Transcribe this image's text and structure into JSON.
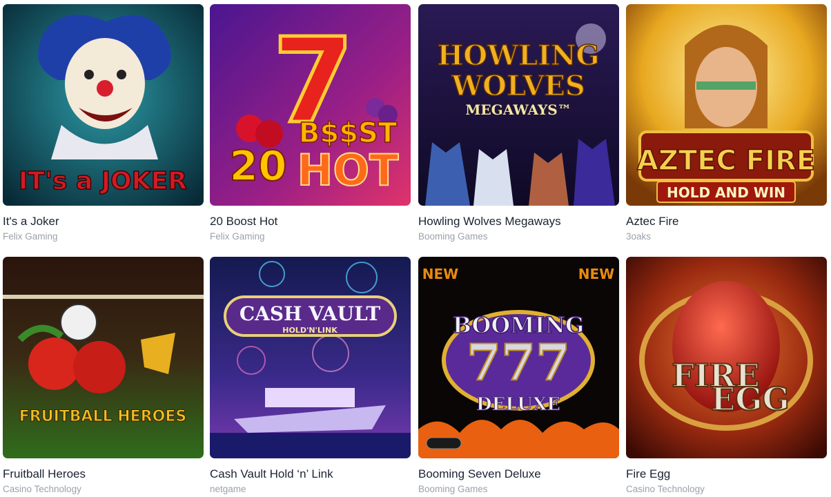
{
  "games": [
    {
      "title": "It's a Joker",
      "provider": "Felix Gaming",
      "art_text": [
        "IT's a JOKER"
      ],
      "art_colors": [
        "#0b3b4a",
        "#1d6f7a",
        "#c8102e"
      ]
    },
    {
      "title": "20 Boost Hot",
      "provider": "Felix Gaming",
      "art_text": [
        "7",
        "B$$ST",
        "20",
        "HOT"
      ],
      "art_colors": [
        "#3a0f6b",
        "#c0237a",
        "#ffb400"
      ]
    },
    {
      "title": "Howling Wolves Megaways",
      "provider": "Booming Games",
      "art_text": [
        "HOWLING",
        "WOLVES",
        "MEGAWAYS™"
      ],
      "art_colors": [
        "#1b1340",
        "#4a2a7a",
        "#e9a11a"
      ]
    },
    {
      "title": "Aztec Fire",
      "provider": "3oaks",
      "art_text": [
        "AZTEC FIRE",
        "HOLD AND WIN"
      ],
      "art_colors": [
        "#f2c640",
        "#8a2b0c",
        "#e8c045"
      ]
    },
    {
      "title": "Fruitball Heroes",
      "provider": "Casino Technology",
      "art_text": [
        "FRUITBALL HEROES"
      ],
      "art_colors": [
        "#2a160c",
        "#2f6d1c",
        "#f0c020"
      ]
    },
    {
      "title": "Cash Vault Hold ‘n’ Link",
      "provider": "netgame",
      "art_text": [
        "CASH VAULT",
        "HOLD'N'LINK"
      ],
      "art_colors": [
        "#1a1f5c",
        "#5a2f9a",
        "#d8c060"
      ]
    },
    {
      "title": "Booming Seven Deluxe",
      "provider": "Booming Games",
      "art_text": [
        "NEW",
        "NEW",
        "BOOMING",
        "777",
        "DELUXE"
      ],
      "art_colors": [
        "#0a0606",
        "#5a2a9a",
        "#e0b030"
      ]
    },
    {
      "title": "Fire Egg",
      "provider": "Casino Technology",
      "art_text": [
        "FIRE",
        "EGG"
      ],
      "art_colors": [
        "#3a0c06",
        "#c43410",
        "#d9a040"
      ]
    }
  ]
}
